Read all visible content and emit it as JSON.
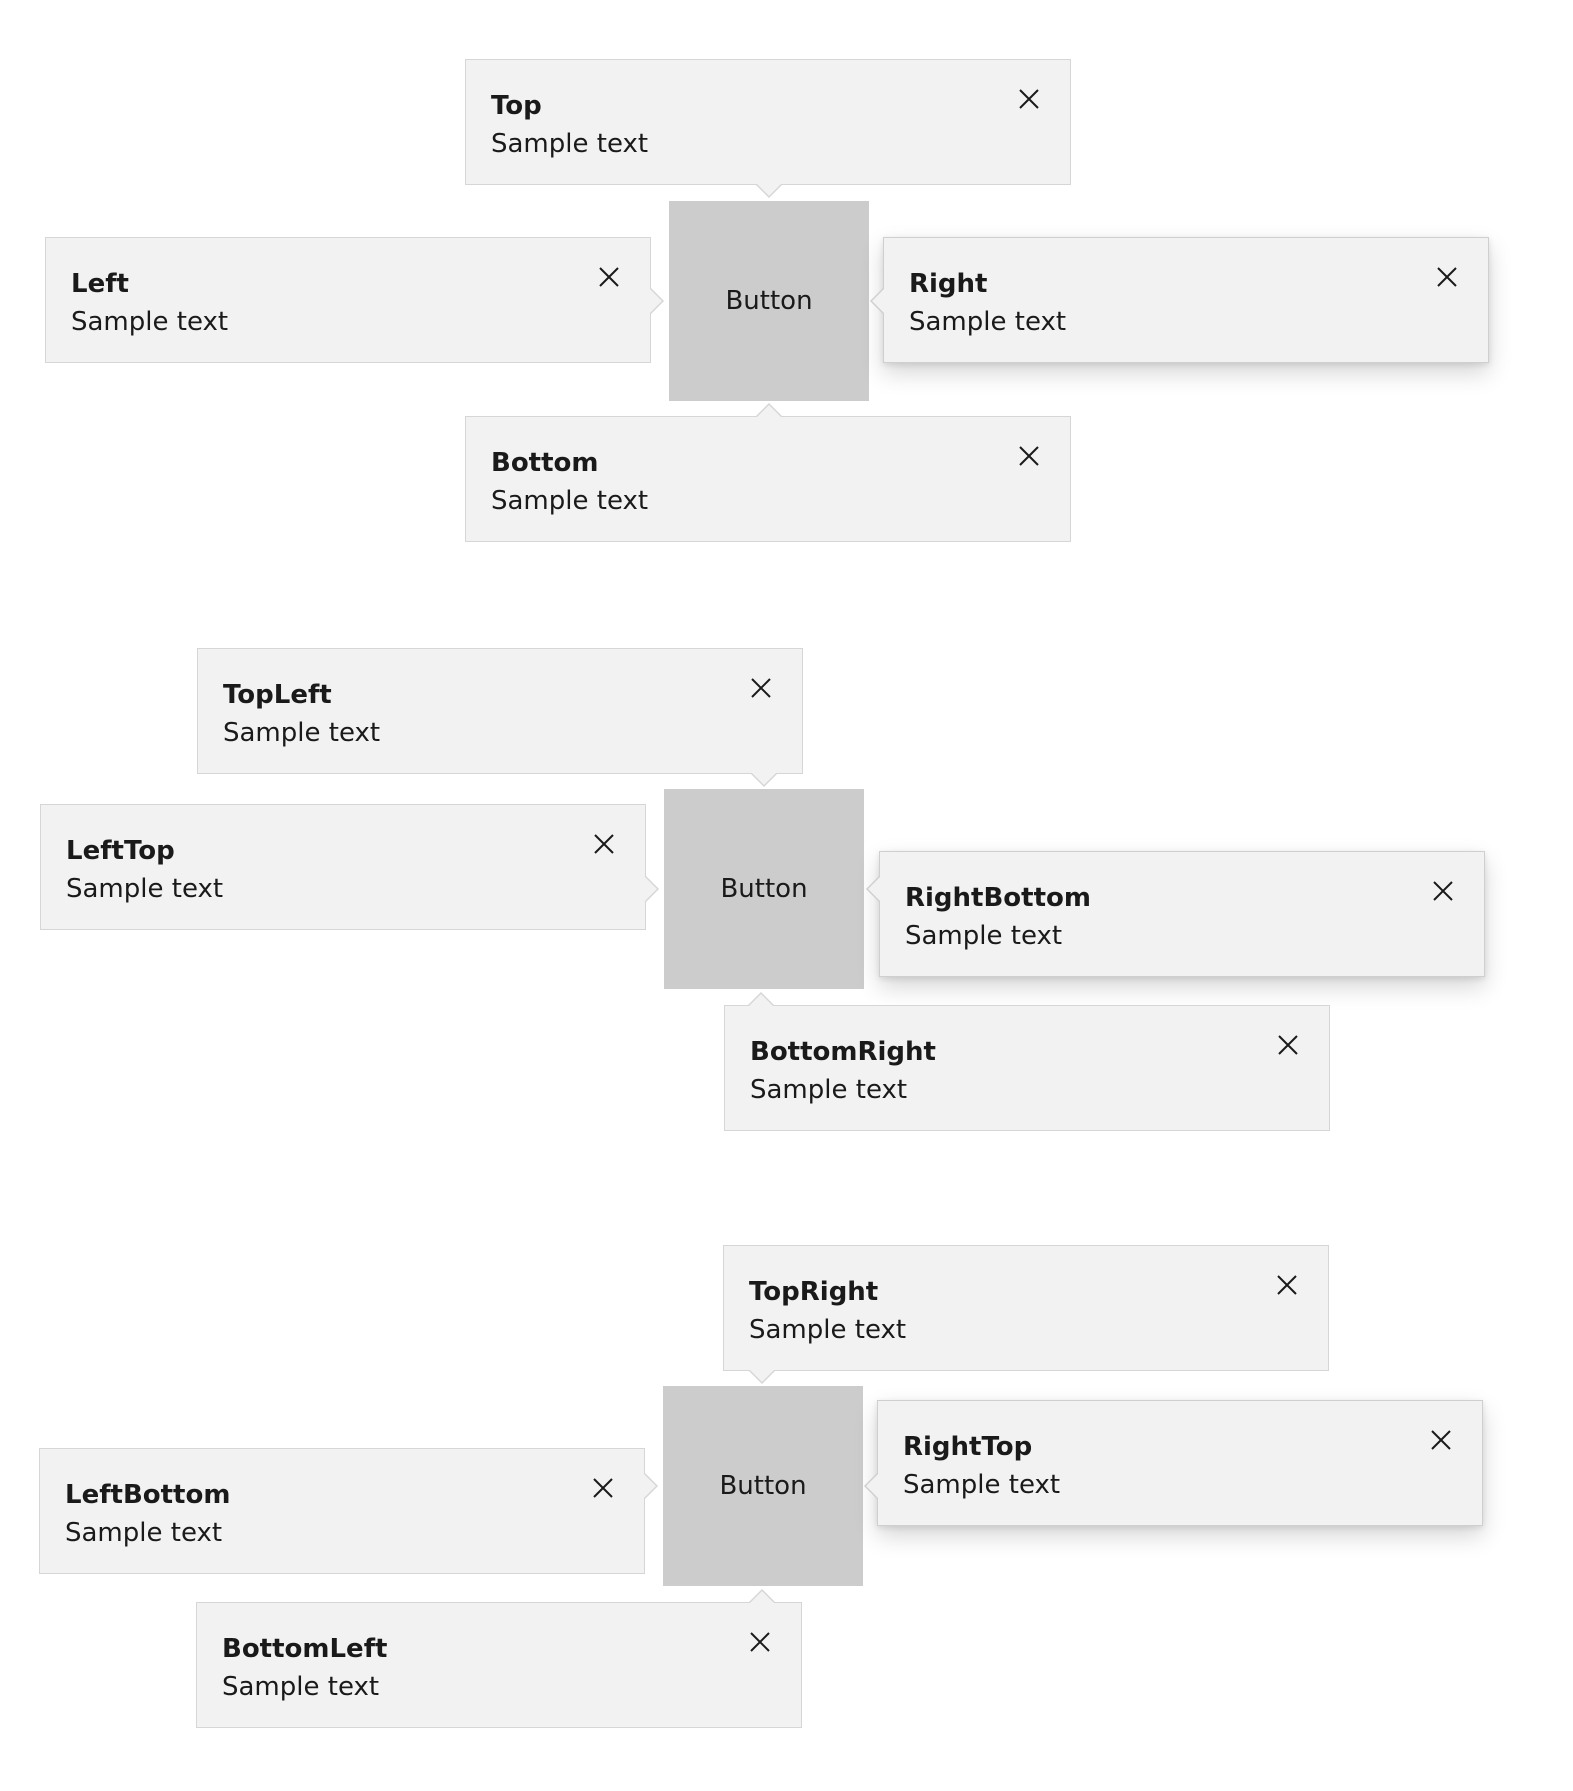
{
  "groups": [
    {
      "button_label": "Button",
      "tips": {
        "top": {
          "title": "Top",
          "subtitle": "Sample text"
        },
        "left": {
          "title": "Left",
          "subtitle": "Sample text"
        },
        "right": {
          "title": "Right",
          "subtitle": "Sample text"
        },
        "bottom": {
          "title": "Bottom",
          "subtitle": "Sample text"
        }
      }
    },
    {
      "button_label": "Button",
      "tips": {
        "topleft": {
          "title": "TopLeft",
          "subtitle": "Sample text"
        },
        "lefttop": {
          "title": "LeftTop",
          "subtitle": "Sample text"
        },
        "rightbottom": {
          "title": "RightBottom",
          "subtitle": "Sample text"
        },
        "bottomright": {
          "title": "BottomRight",
          "subtitle": "Sample text"
        }
      }
    },
    {
      "button_label": "Button",
      "tips": {
        "topright": {
          "title": "TopRight",
          "subtitle": "Sample text"
        },
        "righttop": {
          "title": "RightTop",
          "subtitle": "Sample text"
        },
        "leftbottom": {
          "title": "LeftBottom",
          "subtitle": "Sample text"
        },
        "bottomleft": {
          "title": "BottomLeft",
          "subtitle": "Sample text"
        }
      }
    }
  ],
  "icons": {
    "close": "close-icon"
  },
  "colors": {
    "button_background": "#cccccc",
    "tip_background": "#f2f2f2",
    "tip_border": "#d6d6d6",
    "page_background": "#ffffff"
  }
}
